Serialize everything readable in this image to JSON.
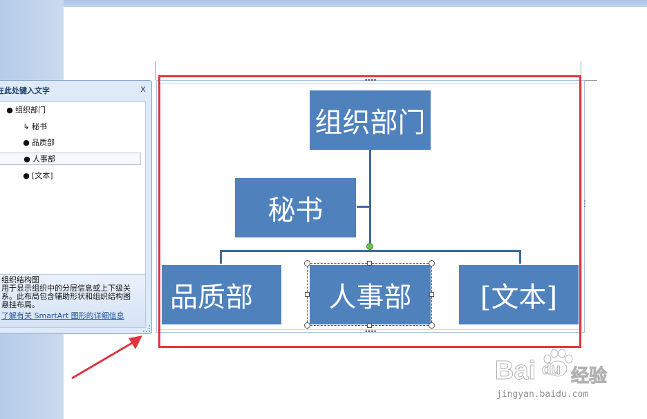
{
  "text_pane": {
    "title": "在此处键入文字",
    "close_label": "x",
    "items": [
      {
        "label": "组织部门",
        "bullet": "●"
      },
      {
        "label": "秘书",
        "bullet": "↳"
      },
      {
        "label": "品质部",
        "bullet": "●"
      },
      {
        "label": "人事部",
        "bullet": "●"
      },
      {
        "label": "[文本]",
        "bullet": "●"
      }
    ],
    "description_title": "组织结构图",
    "description_lines": [
      "用于显示组织中的分层信息或上下级关",
      "系。此布局包含辅助形状和组织结构图",
      "悬挂布局。"
    ],
    "more_link": "了解有关 SmartArt 图形的详细信息"
  },
  "diagram": {
    "top": "组织部门",
    "assistant": "秘书",
    "children": [
      "品质部",
      "人事部",
      "[文本]"
    ]
  },
  "handles": {
    "dots": "••••",
    "grip": "⋮"
  },
  "watermark": {
    "brand": "Bai",
    "du": "du",
    "jingyan": "经验",
    "url": "jingyan.baidu.com"
  },
  "colors": {
    "shape_fill": "#4f81bd",
    "highlight": "#e0353e",
    "rotate_handle": "#6cc24a"
  }
}
